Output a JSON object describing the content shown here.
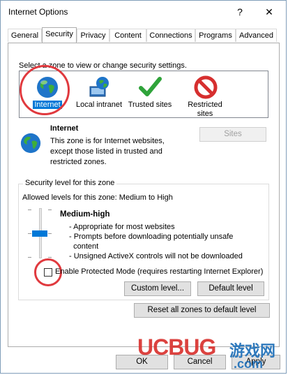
{
  "window": {
    "title": "Internet Options",
    "help_glyph": "?",
    "close_glyph": "✕"
  },
  "tabs": [
    "General",
    "Security",
    "Privacy",
    "Content",
    "Connections",
    "Programs",
    "Advanced"
  ],
  "active_tab": "Security",
  "security": {
    "zone_prompt": "Select a zone to view or change security settings.",
    "zones": [
      {
        "label": "Internet",
        "icon": "globe-icon",
        "selected": true
      },
      {
        "label": "Local intranet",
        "icon": "intranet-icon",
        "selected": false
      },
      {
        "label": "Trusted sites",
        "icon": "checkmark-icon",
        "selected": false
      },
      {
        "label": "Restricted sites",
        "icon": "no-entry-icon",
        "selected": false
      }
    ],
    "zone_info": {
      "title": "Internet",
      "desc_lines": [
        "This zone is for Internet websites,",
        "except those listed in trusted and",
        "restricted zones."
      ],
      "sites_button": "Sites"
    },
    "security_level": {
      "group_title": "Security level for this zone",
      "allowed": "Allowed levels for this zone: Medium to High",
      "level_name": "Medium-high",
      "bullets": [
        "- Appropriate for most websites",
        "- Prompts before downloading potentially unsafe",
        "  content",
        "- Unsigned ActiveX controls will not be downloaded"
      ],
      "slider_level": "Medium-high"
    },
    "protected_mode": {
      "label": "Enable Protected Mode (requires restarting Internet Explorer)",
      "checked": false
    },
    "custom_level_button": "Custom level...",
    "default_level_button": "Default level",
    "reset_all_button": "Reset all zones to default level"
  },
  "footer": {
    "ok": "OK",
    "cancel": "Cancel",
    "apply": "Apply"
  },
  "watermark": {
    "brand": "UCBUG",
    "cn": "游戏网",
    "domain": ".com"
  },
  "colors": {
    "selection": "#0078d7",
    "highlight_ring": "#e0393e",
    "watermark_red": "#d9322f",
    "watermark_blue": "#1e6fb8"
  }
}
